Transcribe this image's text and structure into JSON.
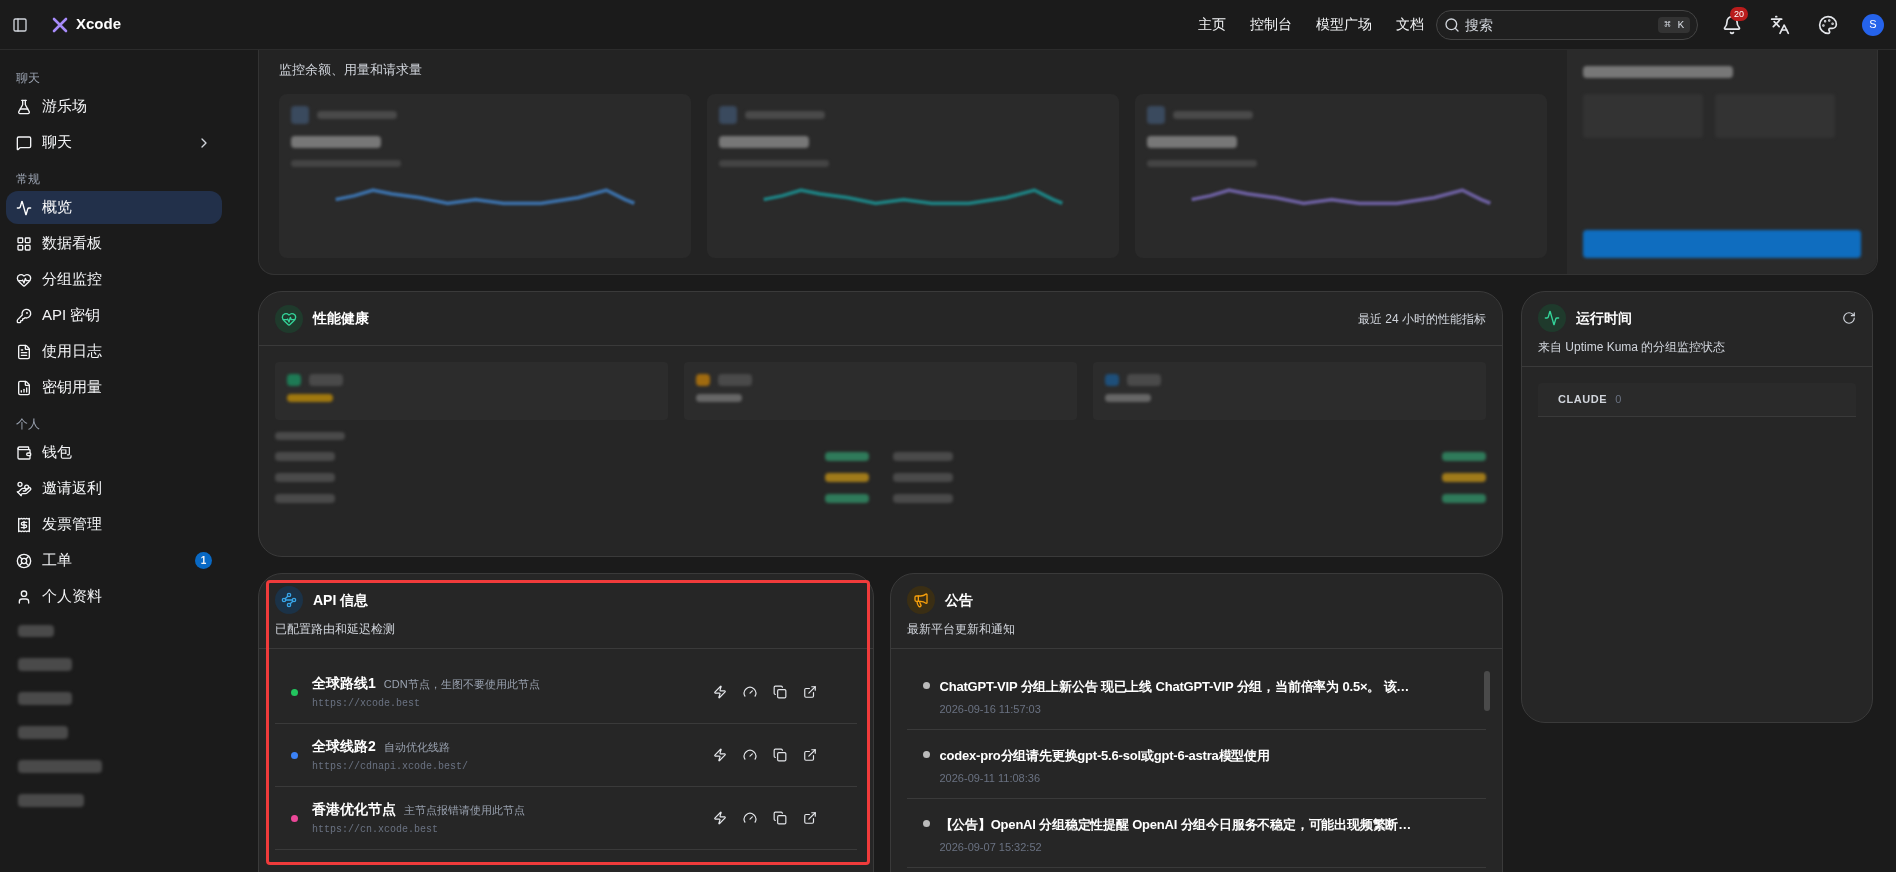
{
  "topbar": {
    "logo": "Xcode",
    "nav": [
      {
        "label": "主页"
      },
      {
        "label": "控制台"
      },
      {
        "label": "模型广场"
      },
      {
        "label": "文档"
      }
    ],
    "search": {
      "placeholder": "搜索",
      "shortcut": "⌘ K"
    },
    "notifications": "20",
    "avatar": "S"
  },
  "sidebar": {
    "sections": [
      {
        "title": "聊天",
        "items": [
          {
            "label": "游乐场",
            "selected": false
          },
          {
            "label": "聊天",
            "selected": false,
            "expanded": false
          }
        ]
      },
      {
        "title": "常规",
        "items": [
          {
            "label": "概览",
            "selected": true
          },
          {
            "label": "数据看板",
            "selected": false
          },
          {
            "label": "分组监控",
            "selected": false
          },
          {
            "label": "API 密钥",
            "selected": false
          },
          {
            "label": "使用日志",
            "selected": false
          },
          {
            "label": "密钥用量",
            "selected": false
          }
        ]
      },
      {
        "title": "个人",
        "items": [
          {
            "label": "钱包",
            "selected": false
          },
          {
            "label": "邀请返利",
            "selected": false
          },
          {
            "label": "发票管理",
            "selected": false
          },
          {
            "label": "工单",
            "selected": false,
            "badge": "1"
          },
          {
            "label": "个人资料",
            "selected": false
          }
        ]
      }
    ]
  },
  "overview": {
    "subtitle": "监控余额、用量和请求量"
  },
  "performance": {
    "title": "性能健康",
    "subtitle": "最近 24 小时的性能指标"
  },
  "uptime": {
    "title": "运行时间",
    "subtitle": "来自 Uptime Kuma 的分组监控状态",
    "groups": [
      {
        "name": "CLAUDE",
        "count": "0"
      }
    ]
  },
  "api_info": {
    "title": "API 信息",
    "subtitle": "已配置路由和延迟检测",
    "highlighted": true,
    "routes": [
      {
        "name": "全球路线1",
        "note": "CDN节点，生图不要使用此节点",
        "url": "https://xcode.best",
        "color": "#22c55e"
      },
      {
        "name": "全球线路2",
        "note": "自动优化线路",
        "url": "https://cdnapi.xcode.best/",
        "color": "#3b82f6"
      },
      {
        "name": "香港优化节点",
        "note": "主节点报错请使用此节点",
        "url": "https://cn.xcode.best",
        "color": "#ec4899"
      }
    ]
  },
  "announcements": {
    "title": "公告",
    "subtitle": "最新平台更新和通知",
    "items": [
      {
        "text": "ChatGPT-VIP 分组上新公告 现已上线 ChatGPT-VIP 分组，当前倍率为 0.5×。 该…",
        "time": "2026-09-16 11:57:03"
      },
      {
        "text": "codex-pro分组请先更换gpt-5.6-sol或gpt-6-astra模型使用",
        "time": "2026-09-11 11:08:36"
      },
      {
        "text": "【公告】OpenAI 分组稳定性提醒 OpenAI 分组今日服务不稳定，可能出现频繁断…",
        "time": "2026-09-07 15:32:52"
      }
    ]
  }
}
